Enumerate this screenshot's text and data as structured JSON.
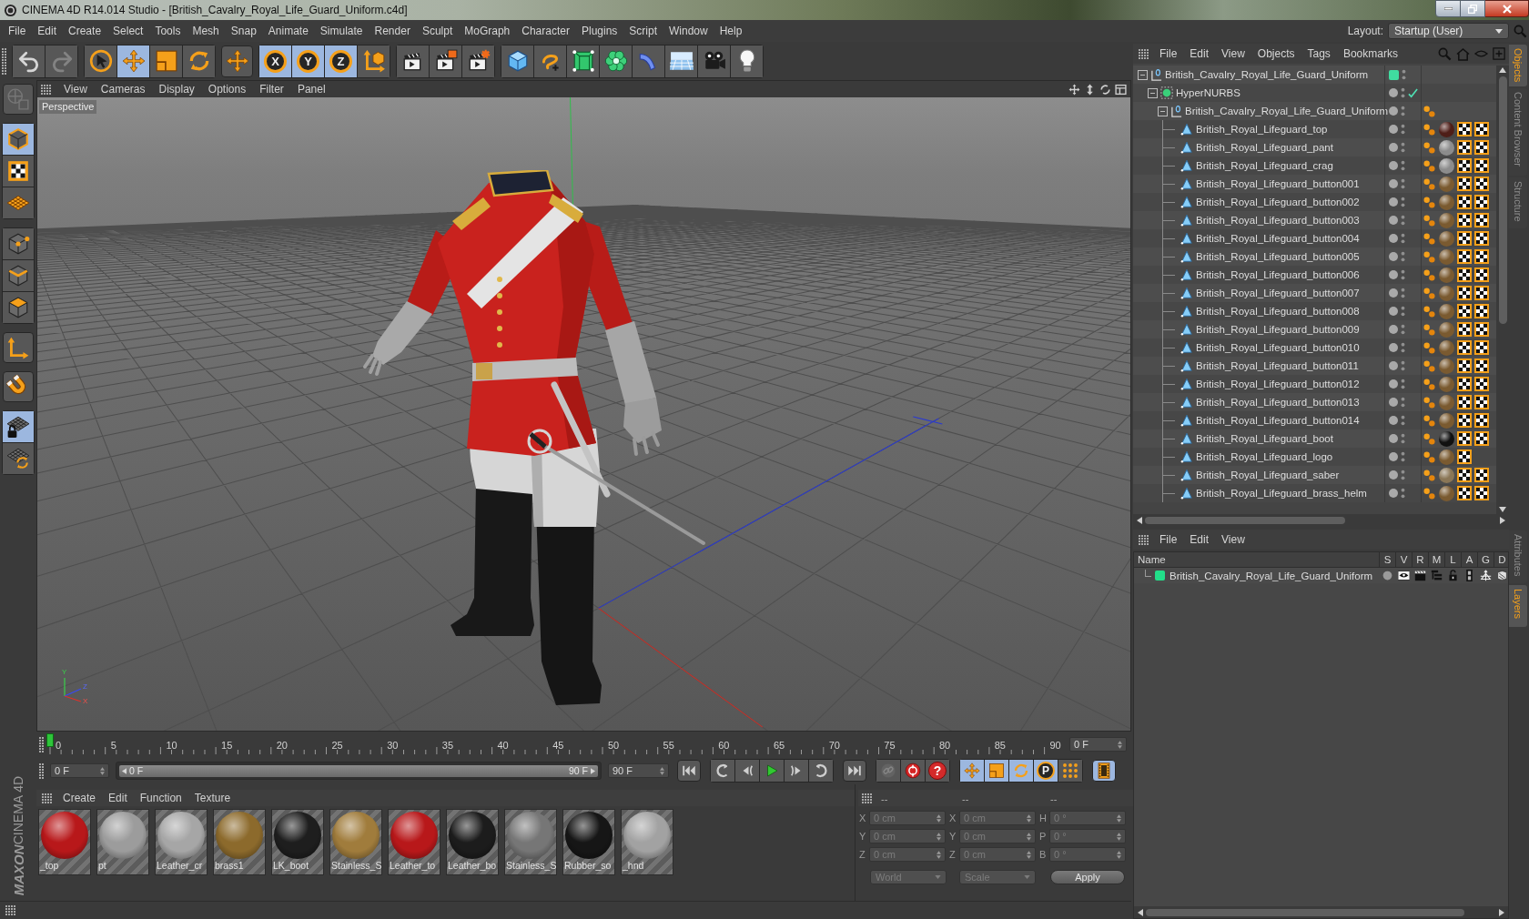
{
  "window": {
    "title": "CINEMA 4D R14.014 Studio - [British_Cavalry_Royal_Life_Guard_Uniform.c4d]"
  },
  "menu_bar": {
    "items": [
      "File",
      "Edit",
      "Create",
      "Select",
      "Tools",
      "Mesh",
      "Snap",
      "Animate",
      "Simulate",
      "Render",
      "Sculpt",
      "MoGraph",
      "Character",
      "Plugins",
      "Script",
      "Window",
      "Help"
    ],
    "layout_label": "Layout:",
    "layout_value": "Startup (User)"
  },
  "toolbar": {
    "groups": [
      [
        {
          "kind": "undo",
          "selected": false,
          "disabled": false
        },
        {
          "kind": "redo",
          "selected": false,
          "disabled": true
        }
      ],
      [
        {
          "kind": "select",
          "selected": false,
          "disabled": false
        },
        {
          "kind": "move",
          "selected": true,
          "disabled": false
        },
        {
          "kind": "scale",
          "selected": false,
          "disabled": false
        },
        {
          "kind": "rotate",
          "selected": false,
          "disabled": false
        }
      ],
      [
        {
          "kind": "last-tool",
          "selected": false,
          "disabled": false
        }
      ],
      [
        {
          "kind": "axis",
          "label": "X",
          "selected": true,
          "disabled": false
        },
        {
          "kind": "axis",
          "label": "Y",
          "selected": true,
          "disabled": false
        },
        {
          "kind": "axis",
          "label": "Z",
          "selected": true,
          "disabled": false
        },
        {
          "kind": "coordinates",
          "selected": false,
          "disabled": false
        }
      ],
      [
        {
          "kind": "render-view",
          "selected": false,
          "disabled": false
        },
        {
          "kind": "render-picture",
          "selected": false,
          "disabled": false
        },
        {
          "kind": "render-settings",
          "selected": false,
          "disabled": false
        }
      ],
      [
        {
          "kind": "cube",
          "selected": false,
          "disabled": false
        },
        {
          "kind": "spline",
          "selected": false,
          "disabled": false
        },
        {
          "kind": "subdivision",
          "selected": false,
          "disabled": false
        },
        {
          "kind": "array",
          "selected": false,
          "disabled": false
        },
        {
          "kind": "deformer",
          "selected": false,
          "disabled": false
        },
        {
          "kind": "floor",
          "selected": false,
          "disabled": false
        },
        {
          "kind": "camera",
          "selected": false,
          "disabled": false
        },
        {
          "kind": "light",
          "selected": false,
          "disabled": false
        }
      ]
    ]
  },
  "left_toolbar": {
    "groups": [
      [
        {
          "kind": "make-editable",
          "selected": false,
          "disabled": true
        }
      ],
      [
        {
          "kind": "model",
          "selected": true,
          "disabled": false
        },
        {
          "kind": "texture",
          "selected": false,
          "disabled": false
        },
        {
          "kind": "workplane",
          "selected": false,
          "disabled": false
        }
      ],
      [
        {
          "kind": "points",
          "selected": false,
          "disabled": false
        },
        {
          "kind": "edges",
          "selected": false,
          "disabled": false
        },
        {
          "kind": "polygons",
          "selected": false,
          "disabled": false
        }
      ],
      [
        {
          "kind": "axis-mode",
          "selected": false,
          "disabled": false
        }
      ],
      [
        {
          "kind": "snap",
          "selected": false,
          "disabled": false
        }
      ],
      [
        {
          "kind": "workplane-lock",
          "selected": true,
          "disabled": false
        },
        {
          "kind": "workplane-align",
          "selected": false,
          "disabled": false
        }
      ]
    ]
  },
  "branding": [
    "MAXON",
    "CINEMA 4D"
  ],
  "viewport": {
    "menu": [
      "View",
      "Cameras",
      "Display",
      "Options",
      "Filter",
      "Panel"
    ],
    "camera": "Perspective",
    "axis_labels": [
      "Y",
      "Z",
      "X"
    ]
  },
  "timeline": {
    "ticks": [
      "0",
      "5",
      "10",
      "15",
      "20",
      "25",
      "30",
      "35",
      "40",
      "45",
      "50",
      "55",
      "60",
      "65",
      "70",
      "75",
      "80",
      "85",
      "90"
    ],
    "playhead": {
      "level": 0
    },
    "frame_field": "0 F"
  },
  "transport": {
    "start_field": "0 F",
    "preview_range": {
      "start": "0 F",
      "end": "90 F",
      "level": 1
    },
    "end_field": "90 F",
    "groups": [
      [
        {
          "kind": "go-start",
          "selected": false,
          "disabled": false
        }
      ],
      [
        {
          "kind": "prev-key",
          "selected": false,
          "disabled": false
        },
        {
          "kind": "prev-frame",
          "selected": false,
          "disabled": false
        },
        {
          "kind": "play",
          "selected": false,
          "disabled": false
        },
        {
          "kind": "next-frame",
          "selected": false,
          "disabled": false
        },
        {
          "kind": "next-key",
          "selected": false,
          "disabled": false
        }
      ],
      [
        {
          "kind": "go-end",
          "selected": false,
          "disabled": false
        }
      ],
      [
        {
          "kind": "record-objects",
          "selected": false,
          "disabled": true
        },
        {
          "kind": "autokey",
          "selected": false,
          "disabled": false
        },
        {
          "kind": "keyframe-selection",
          "label": "?",
          "selected": false,
          "disabled": false
        }
      ],
      [
        {
          "kind": "key-position",
          "selected": true,
          "disabled": false
        },
        {
          "kind": "key-scale",
          "selected": true,
          "disabled": false
        },
        {
          "kind": "key-rotation",
          "selected": true,
          "disabled": false
        },
        {
          "kind": "key-parameter",
          "label": "P",
          "selected": true,
          "disabled": false
        },
        {
          "kind": "key-points",
          "selected": false,
          "disabled": false
        }
      ],
      [
        {
          "kind": "timeline-window",
          "selected": true,
          "disabled": false
        }
      ]
    ]
  },
  "materials": {
    "menu": [
      "Create",
      "Edit",
      "Function",
      "Texture"
    ],
    "items": [
      {
        "name": "_top",
        "color": "#b8181a"
      },
      {
        "name": "pt",
        "color": "#9c9c9c"
      },
      {
        "name": "Leather_cr",
        "color": "#a6a6a6"
      },
      {
        "name": "brass1",
        "color": "#8c6a2c"
      },
      {
        "name": "LK_boot",
        "color": "#1e1e1e"
      },
      {
        "name": "Stainless_S",
        "color": "#a07c3c"
      },
      {
        "name": "Leather_to",
        "color": "#b8181a"
      },
      {
        "name": "Leather_bo",
        "color": "#1c1c1c"
      },
      {
        "name": "Stainless_S",
        "color": "#767676"
      },
      {
        "name": "Rubber_so",
        "color": "#161616"
      },
      {
        "name": "_hnd",
        "color": "#a2a2a2"
      }
    ]
  },
  "coordinates": {
    "disabled": true,
    "headers": [
      "--",
      "--",
      "--"
    ],
    "rows": [
      [
        {
          "axis": "X",
          "value": "0 cm"
        },
        {
          "axis": "X",
          "value": "0 cm"
        },
        {
          "axis": "H",
          "value": "0 °"
        }
      ],
      [
        {
          "axis": "Y",
          "value": "0 cm"
        },
        {
          "axis": "Y",
          "value": "0 cm"
        },
        {
          "axis": "P",
          "value": "0 °"
        }
      ],
      [
        {
          "axis": "Z",
          "value": "0 cm"
        },
        {
          "axis": "Z",
          "value": "0 cm"
        },
        {
          "axis": "B",
          "value": "0 °"
        }
      ]
    ],
    "space": "World",
    "mode": "Scale",
    "apply": "Apply"
  },
  "objects_manager": {
    "menu": [
      "File",
      "Edit",
      "View",
      "Objects",
      "Tags",
      "Bookmarks"
    ],
    "objects": [
      {
        "name": "British_Cavalry_Royal_Life_Guard_Uniform",
        "kind": "null",
        "expanded": true,
        "color": "#40dca0",
        "children": [
          {
            "name": "HyperNURBS",
            "kind": "hypernurbs",
            "expanded": true,
            "enabled": true,
            "children": [
              {
                "name": "British_Cavalry_Royal_Life_Guard_Uniform",
                "kind": "null",
                "expanded": true,
                "tags": [
                  {
                    "kind": "phong"
                  }
                ],
                "children": [
                  {
                    "name": "British_Royal_Lifeguard_top",
                    "kind": "polygon",
                    "tags": [
                      {
                        "kind": "phong"
                      },
                      {
                        "kind": "material",
                        "color": "#4e1e18"
                      },
                      {
                        "kind": "texture"
                      },
                      {
                        "kind": "texture"
                      }
                    ]
                  },
                  {
                    "name": "British_Royal_Lifeguard_pant",
                    "kind": "polygon",
                    "tags": [
                      {
                        "kind": "phong"
                      },
                      {
                        "kind": "material",
                        "color": "#8c8c8c"
                      },
                      {
                        "kind": "texture"
                      },
                      {
                        "kind": "texture"
                      }
                    ]
                  },
                  {
                    "name": "British_Royal_Lifeguard_crag",
                    "kind": "polygon",
                    "tags": [
                      {
                        "kind": "phong"
                      },
                      {
                        "kind": "material",
                        "color": "#8c8c8c"
                      },
                      {
                        "kind": "texture"
                      },
                      {
                        "kind": "texture"
                      }
                    ]
                  },
                  {
                    "name": "British_Royal_Lifeguard_button001",
                    "kind": "polygon",
                    "tags": [
                      {
                        "kind": "phong"
                      },
                      {
                        "kind": "material",
                        "color": "#7a5a30"
                      },
                      {
                        "kind": "texture"
                      },
                      {
                        "kind": "texture"
                      }
                    ]
                  },
                  {
                    "name": "British_Royal_Lifeguard_button002",
                    "kind": "polygon",
                    "tags": [
                      {
                        "kind": "phong"
                      },
                      {
                        "kind": "material",
                        "color": "#7a5a30"
                      },
                      {
                        "kind": "texture"
                      },
                      {
                        "kind": "texture"
                      }
                    ]
                  },
                  {
                    "name": "British_Royal_Lifeguard_button003",
                    "kind": "polygon",
                    "tags": [
                      {
                        "kind": "phong"
                      },
                      {
                        "kind": "material",
                        "color": "#7a5a30"
                      },
                      {
                        "kind": "texture"
                      },
                      {
                        "kind": "texture"
                      }
                    ]
                  },
                  {
                    "name": "British_Royal_Lifeguard_button004",
                    "kind": "polygon",
                    "tags": [
                      {
                        "kind": "phong"
                      },
                      {
                        "kind": "material",
                        "color": "#7a5a30"
                      },
                      {
                        "kind": "texture"
                      },
                      {
                        "kind": "texture"
                      }
                    ]
                  },
                  {
                    "name": "British_Royal_Lifeguard_button005",
                    "kind": "polygon",
                    "tags": [
                      {
                        "kind": "phong"
                      },
                      {
                        "kind": "material",
                        "color": "#7a5a30"
                      },
                      {
                        "kind": "texture"
                      },
                      {
                        "kind": "texture"
                      }
                    ]
                  },
                  {
                    "name": "British_Royal_Lifeguard_button006",
                    "kind": "polygon",
                    "tags": [
                      {
                        "kind": "phong"
                      },
                      {
                        "kind": "material",
                        "color": "#7a5a30"
                      },
                      {
                        "kind": "texture"
                      },
                      {
                        "kind": "texture"
                      }
                    ]
                  },
                  {
                    "name": "British_Royal_Lifeguard_button007",
                    "kind": "polygon",
                    "tags": [
                      {
                        "kind": "phong"
                      },
                      {
                        "kind": "material",
                        "color": "#7a5a30"
                      },
                      {
                        "kind": "texture"
                      },
                      {
                        "kind": "texture"
                      }
                    ]
                  },
                  {
                    "name": "British_Royal_Lifeguard_button008",
                    "kind": "polygon",
                    "tags": [
                      {
                        "kind": "phong"
                      },
                      {
                        "kind": "material",
                        "color": "#7a5a30"
                      },
                      {
                        "kind": "texture"
                      },
                      {
                        "kind": "texture"
                      }
                    ]
                  },
                  {
                    "name": "British_Royal_Lifeguard_button009",
                    "kind": "polygon",
                    "tags": [
                      {
                        "kind": "phong"
                      },
                      {
                        "kind": "material",
                        "color": "#7a5a30"
                      },
                      {
                        "kind": "texture"
                      },
                      {
                        "kind": "texture"
                      }
                    ]
                  },
                  {
                    "name": "British_Royal_Lifeguard_button010",
                    "kind": "polygon",
                    "tags": [
                      {
                        "kind": "phong"
                      },
                      {
                        "kind": "material",
                        "color": "#7a5a30"
                      },
                      {
                        "kind": "texture"
                      },
                      {
                        "kind": "texture"
                      }
                    ]
                  },
                  {
                    "name": "British_Royal_Lifeguard_button011",
                    "kind": "polygon",
                    "tags": [
                      {
                        "kind": "phong"
                      },
                      {
                        "kind": "material",
                        "color": "#7a5a30"
                      },
                      {
                        "kind": "texture"
                      },
                      {
                        "kind": "texture"
                      }
                    ]
                  },
                  {
                    "name": "British_Royal_Lifeguard_button012",
                    "kind": "polygon",
                    "tags": [
                      {
                        "kind": "phong"
                      },
                      {
                        "kind": "material",
                        "color": "#7a5a30"
                      },
                      {
                        "kind": "texture"
                      },
                      {
                        "kind": "texture"
                      }
                    ]
                  },
                  {
                    "name": "British_Royal_Lifeguard_button013",
                    "kind": "polygon",
                    "tags": [
                      {
                        "kind": "phong"
                      },
                      {
                        "kind": "material",
                        "color": "#7a5a30"
                      },
                      {
                        "kind": "texture"
                      },
                      {
                        "kind": "texture"
                      }
                    ]
                  },
                  {
                    "name": "British_Royal_Lifeguard_button014",
                    "kind": "polygon",
                    "tags": [
                      {
                        "kind": "phong"
                      },
                      {
                        "kind": "material",
                        "color": "#7a5a30"
                      },
                      {
                        "kind": "texture"
                      },
                      {
                        "kind": "texture"
                      }
                    ]
                  },
                  {
                    "name": "British_Royal_Lifeguard_boot",
                    "kind": "polygon",
                    "tags": [
                      {
                        "kind": "phong"
                      },
                      {
                        "kind": "material",
                        "color": "#111111"
                      },
                      {
                        "kind": "texture"
                      },
                      {
                        "kind": "texture"
                      }
                    ]
                  },
                  {
                    "name": "British_Royal_Lifeguard_logo",
                    "kind": "polygon",
                    "tags": [
                      {
                        "kind": "phong"
                      },
                      {
                        "kind": "material",
                        "color": "#7a5a30"
                      },
                      {
                        "kind": "texture"
                      }
                    ]
                  },
                  {
                    "name": "British_Royal_Lifeguard_saber",
                    "kind": "polygon",
                    "tags": [
                      {
                        "kind": "phong"
                      },
                      {
                        "kind": "material",
                        "color": "#8a7656"
                      },
                      {
                        "kind": "texture"
                      },
                      {
                        "kind": "texture"
                      }
                    ]
                  },
                  {
                    "name": "British_Royal_Lifeguard_brass_helm",
                    "kind": "polygon",
                    "tags": [
                      {
                        "kind": "phong"
                      },
                      {
                        "kind": "material",
                        "color": "#7a5a30"
                      },
                      {
                        "kind": "texture"
                      },
                      {
                        "kind": "texture"
                      }
                    ]
                  }
                ]
              }
            ]
          }
        ]
      }
    ]
  },
  "layers_manager": {
    "menu": [
      "File",
      "Edit",
      "View"
    ],
    "columns": [
      "Name",
      "S",
      "V",
      "R",
      "M",
      "L",
      "A",
      "G",
      "D"
    ],
    "layers": [
      {
        "name": "British_Cavalry_Royal_Life_Guard_Uniform",
        "color": "#22e08a"
      }
    ]
  },
  "side_tabs": {
    "top": [
      {
        "label": "Objects",
        "selected": true
      },
      {
        "label": "Content Browser",
        "selected": false
      },
      {
        "label": "Structure",
        "selected": false
      }
    ],
    "bottom": [
      {
        "label": "Attributes",
        "selected": false
      },
      {
        "label": "Layers",
        "selected": true
      }
    ]
  }
}
